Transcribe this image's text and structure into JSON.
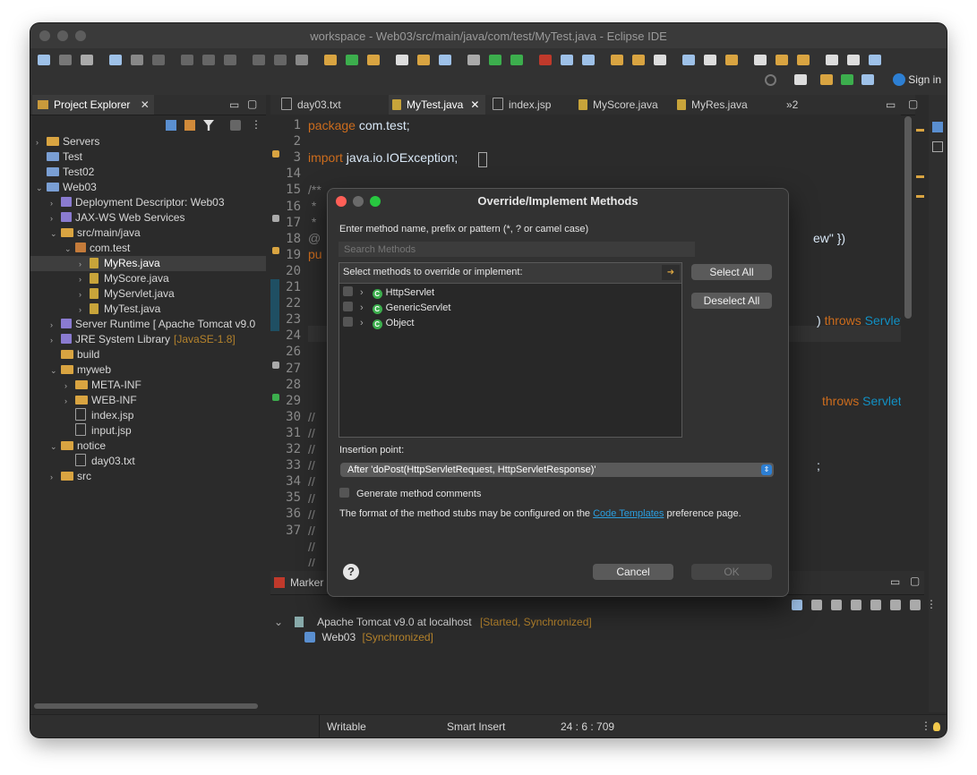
{
  "window": {
    "title": "workspace - Web03/src/main/java/com/test/MyTest.java - Eclipse IDE",
    "sign_in": "Sign in"
  },
  "project_explorer": {
    "title": "Project Explorer",
    "items": [
      {
        "label": "Servers",
        "depth": 0,
        "twisty": "›",
        "icon": "folder"
      },
      {
        "label": "Test",
        "depth": 0,
        "twisty": "",
        "icon": "project"
      },
      {
        "label": "Test02",
        "depth": 0,
        "twisty": "",
        "icon": "project"
      },
      {
        "label": "Web03",
        "depth": 0,
        "twisty": "⌄",
        "icon": "project"
      },
      {
        "label": "Deployment Descriptor: Web03",
        "depth": 1,
        "twisty": "›",
        "icon": "descriptor"
      },
      {
        "label": "JAX-WS Web Services",
        "depth": 1,
        "twisty": "›",
        "icon": "descriptor"
      },
      {
        "label": "src/main/java",
        "depth": 1,
        "twisty": "⌄",
        "icon": "folder"
      },
      {
        "label": "com.test",
        "depth": 2,
        "twisty": "⌄",
        "icon": "package"
      },
      {
        "label": "MyRes.java",
        "depth": 3,
        "twisty": "›",
        "icon": "java",
        "selected": true
      },
      {
        "label": "MyScore.java",
        "depth": 3,
        "twisty": "›",
        "icon": "java"
      },
      {
        "label": "MyServlet.java",
        "depth": 3,
        "twisty": "›",
        "icon": "java"
      },
      {
        "label": "MyTest.java",
        "depth": 3,
        "twisty": "›",
        "icon": "java"
      },
      {
        "label": "Server Runtime [   Apache Tomcat v9.0",
        "depth": 1,
        "twisty": "›",
        "icon": "library"
      },
      {
        "label": "JRE System Library",
        "hint": "[JavaSE-1.8]",
        "depth": 1,
        "twisty": "›",
        "icon": "library"
      },
      {
        "label": "build",
        "depth": 1,
        "twisty": "",
        "icon": "folder"
      },
      {
        "label": "myweb",
        "depth": 1,
        "twisty": "⌄",
        "icon": "folder"
      },
      {
        "label": "META-INF",
        "depth": 2,
        "twisty": "›",
        "icon": "folder"
      },
      {
        "label": "WEB-INF",
        "depth": 2,
        "twisty": "›",
        "icon": "folder"
      },
      {
        "label": "index.jsp",
        "depth": 2,
        "twisty": "",
        "icon": "file"
      },
      {
        "label": "input.jsp",
        "depth": 2,
        "twisty": "",
        "icon": "file"
      },
      {
        "label": "notice",
        "depth": 1,
        "twisty": "⌄",
        "icon": "folder"
      },
      {
        "label": "day03.txt",
        "depth": 2,
        "twisty": "",
        "icon": "file"
      },
      {
        "label": "src",
        "depth": 1,
        "twisty": "›",
        "icon": "folder"
      }
    ]
  },
  "editor": {
    "tabs": [
      {
        "label": "day03.txt",
        "icon": "file"
      },
      {
        "label": "MyTest.java",
        "icon": "java",
        "active": true
      },
      {
        "label": "index.jsp",
        "icon": "file"
      },
      {
        "label": "MyScore.java",
        "icon": "java"
      },
      {
        "label": "MyRes.java",
        "icon": "java"
      }
    ],
    "overflow": "»2",
    "line_numbers": [
      "1",
      "2",
      "3",
      "14",
      "15",
      "16",
      "17",
      "18",
      "19",
      "20",
      "21",
      "22",
      "23",
      "24",
      "26",
      "27",
      "28",
      "29",
      "30",
      "31",
      "32",
      "33",
      "34",
      "35",
      "36",
      "37"
    ],
    "code": {
      "package_kw": "package",
      "package_name": " com.test;",
      "import_kw": "import",
      "import_name": " java.io.IOException;",
      "comment_open": "/**",
      "comment_star1": " *",
      "comment_star2": " *",
      "annotation_start": "@",
      "annotation_tail": "ew\" })",
      "pub_start": "pu",
      "throws1_kw": "throws",
      "throws1_type": " ServletEx",
      "throws2_kw": "throws",
      "throws2_type": " ServletEx",
      "paren": ") ",
      "semicolon": ";",
      "slash": "//"
    }
  },
  "dialog": {
    "title": "Override/Implement Methods",
    "prompt": "Enter method name, prefix or pattern (*, ? or camel case)",
    "search_placeholder": "Search Methods",
    "list_header": "Select methods to override or implement:",
    "methods": [
      {
        "label": "HttpServlet"
      },
      {
        "label": "GenericServlet"
      },
      {
        "label": "Object"
      }
    ],
    "select_all": "Select All",
    "deselect_all": "Deselect All",
    "insertion_label": "Insertion point:",
    "insertion_value": "After 'doPost(HttpServletRequest, HttpServletResponse)'",
    "generate_comments": "Generate method comments",
    "info_prefix": "The format of the method stubs may be configured on the ",
    "info_link": "Code Templates",
    "info_suffix": " preference page.",
    "cancel": "Cancel",
    "ok": "OK",
    "help": "?"
  },
  "servers": {
    "tab_label": "Marker",
    "server": "Apache Tomcat v9.0 at localhost",
    "server_state": "[Started, Synchronized]",
    "module": "Web03",
    "module_state": "[Synchronized]"
  },
  "status_bar": {
    "writable": "Writable",
    "insert_mode": "Smart Insert",
    "position": "24 : 6 : 709"
  },
  "colors": {
    "keyword": "#cc6c1d",
    "type": "#1290c3",
    "comment": "#808080",
    "accent_link": "#2a9fe0",
    "hint": "#b5832c"
  }
}
